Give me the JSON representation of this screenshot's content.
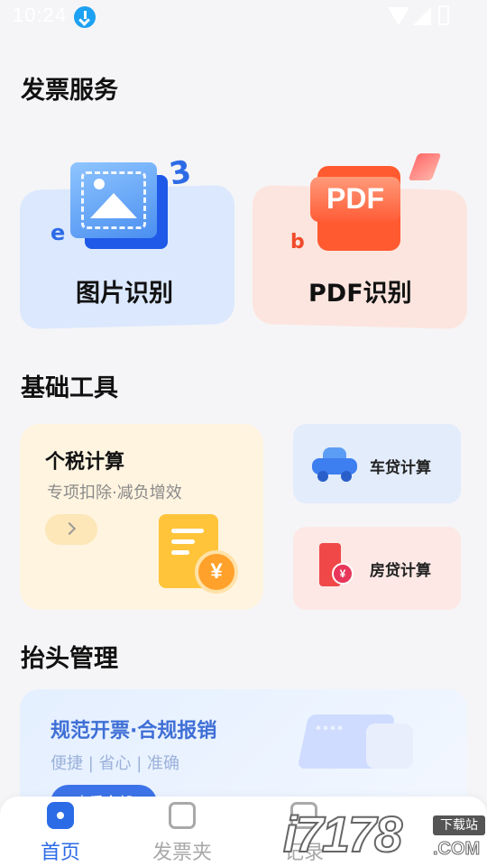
{
  "status_bar": {
    "time": "10:24"
  },
  "invoice_service": {
    "title": "发票服务",
    "image_recognition_label": "图片识别",
    "pdf_recognition_label": "PDF识别",
    "pdf_badge_text": "PDF"
  },
  "basic_tools": {
    "title": "基础工具",
    "income_tax": {
      "title": "个税计算",
      "subtitle": "专项扣除·减负增效"
    },
    "car_loan_label": "车贷计算",
    "mortgage_label": "房贷计算"
  },
  "title_management": {
    "title": "抬头管理",
    "banner_title": "规范开票·合规报销",
    "banner_subtitle": "便捷 | 省心 | 准确",
    "banner_button": "查看全部"
  },
  "tab_bar": {
    "tabs": [
      {
        "label": "首页",
        "icon": "home-icon",
        "active": true
      },
      {
        "label": "发票夹",
        "icon": "invoice-folder-icon",
        "active": false
      },
      {
        "label": "记录",
        "icon": "record-icon",
        "active": false
      }
    ]
  },
  "watermark": {
    "number": "i7178",
    "tag": "下载站",
    "domain": ".COM"
  },
  "colors": {
    "accent": "#2c6be6",
    "background": "#f5f5f7"
  }
}
